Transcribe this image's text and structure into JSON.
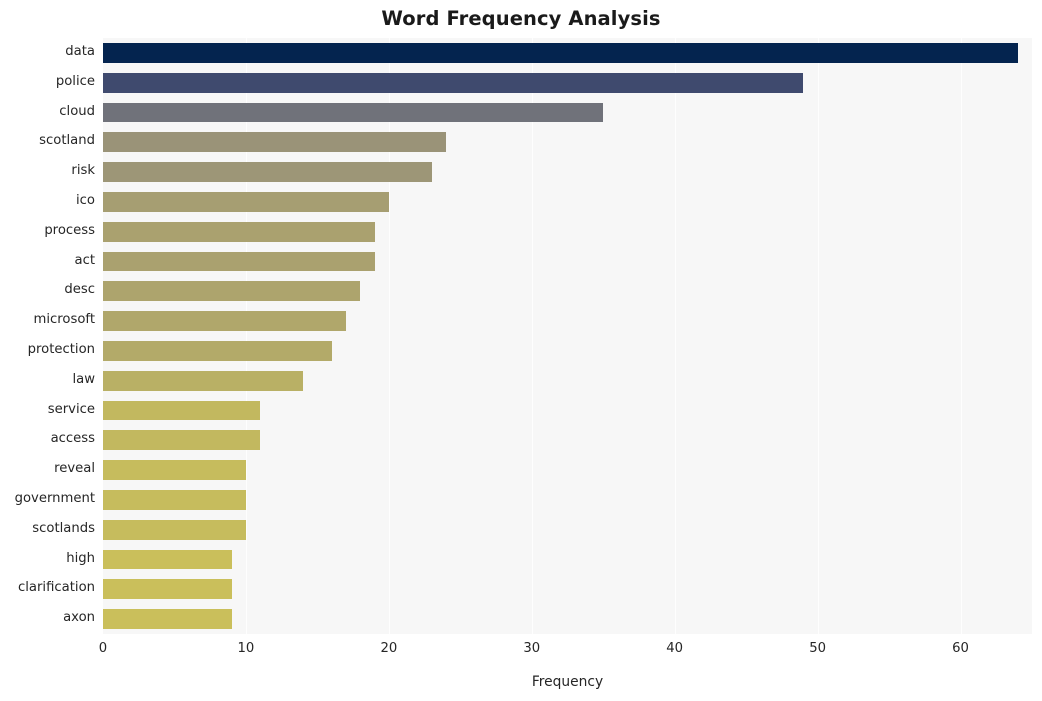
{
  "chart_data": {
    "type": "bar",
    "orientation": "horizontal",
    "title": "Word Frequency Analysis",
    "xlabel": "Frequency",
    "ylabel": "",
    "xlim": [
      0,
      65
    ],
    "xticks": [
      0,
      10,
      20,
      30,
      40,
      50,
      60
    ],
    "xtick_labels": [
      "0",
      "10",
      "20",
      "30",
      "40",
      "50",
      "60"
    ],
    "grid": "vertical-only",
    "legend": "none",
    "plot_background": "#f7f7f7",
    "figure_background": "#ffffff",
    "categories": [
      "data",
      "police",
      "cloud",
      "scotland",
      "risk",
      "ico",
      "process",
      "act",
      "desc",
      "microsoft",
      "protection",
      "law",
      "service",
      "access",
      "reveal",
      "government",
      "scotlands",
      "high",
      "clarification",
      "axon"
    ],
    "values": [
      64,
      49,
      35,
      24,
      23,
      20,
      19,
      19,
      18,
      17,
      16,
      14,
      11,
      11,
      10,
      10,
      10,
      9,
      9,
      9
    ],
    "bar_colors": [
      "#04244f",
      "#3f4a6e",
      "#70727a",
      "#9a9378",
      "#9d9677",
      "#a69e72",
      "#aaa16f",
      "#aaa16f",
      "#ada46d",
      "#b0a76b",
      "#b3aa69",
      "#b9b065",
      "#c2b85f",
      "#c2b85f",
      "#c6bc5d",
      "#c6bc5d",
      "#c6bc5d",
      "#cabf5b",
      "#cabf5b",
      "#cabf5b"
    ]
  }
}
